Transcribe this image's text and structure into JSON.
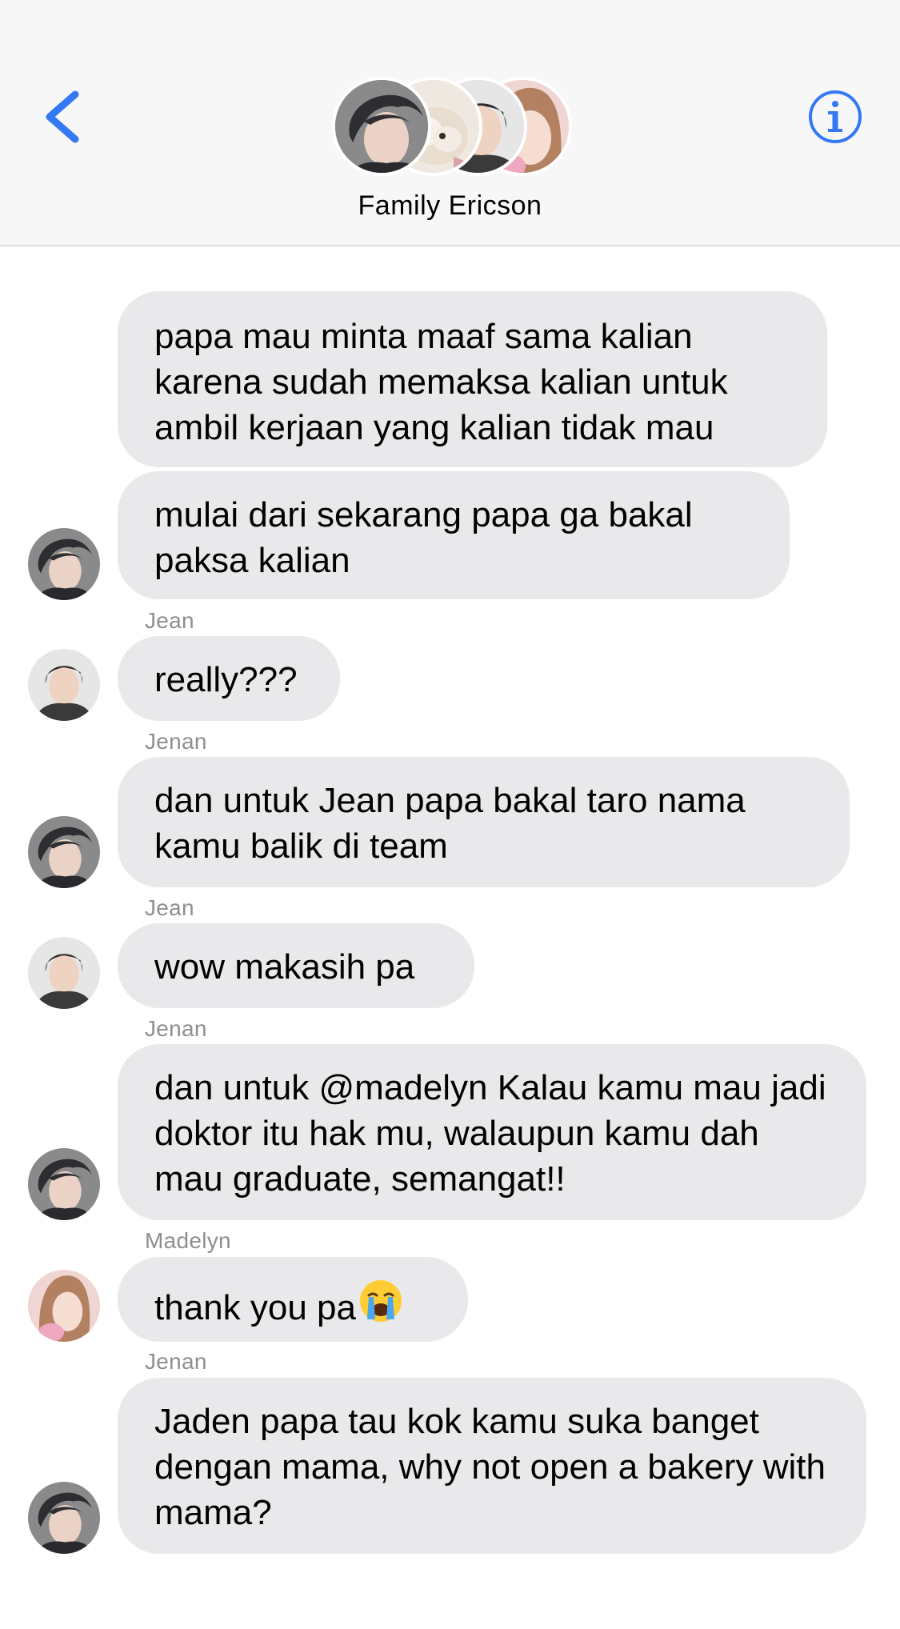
{
  "header": {
    "title": "Family Ericson",
    "back_icon": "chevron-left-icon",
    "info_icon": "info-circle-icon",
    "accent_color": "#3478f6"
  },
  "messages": [
    {
      "sender": "",
      "text": "papa mau minta maaf sama kalian karena sudah memaksa kalian untuk ambil kerjaan yang kalian tidak mau",
      "avatar": "papa"
    },
    {
      "sender": "",
      "text": "mulai dari sekarang papa ga bakal paksa kalian",
      "avatar": "papa"
    },
    {
      "sender": "Jean",
      "text": "really???",
      "avatar": "jean"
    },
    {
      "sender": "Jenan",
      "text": "dan untuk Jean papa bakal taro nama kamu balik di team",
      "avatar": "papa"
    },
    {
      "sender": "Jean",
      "text": "wow makasih pa",
      "avatar": "jean"
    },
    {
      "sender": "Jenan",
      "text": "dan untuk @madelyn Kalau kamu mau jadi doktor itu hak mu, walaupun kamu dah mau graduate, semangat!!",
      "avatar": "papa"
    },
    {
      "sender": "Madelyn",
      "text": "thank you pa",
      "emoji": "loudly-crying-face-emoji",
      "avatar": "madelyn"
    },
    {
      "sender": "Jenan",
      "text": "Jaden papa tau kok kamu suka banget dengan mama, why not open a bakery with mama?",
      "avatar": "papa"
    }
  ],
  "colors": {
    "bubble_bg": "#e9e9eb",
    "sender_label": "#8e8e93",
    "header_bg": "#f7f7f7"
  }
}
